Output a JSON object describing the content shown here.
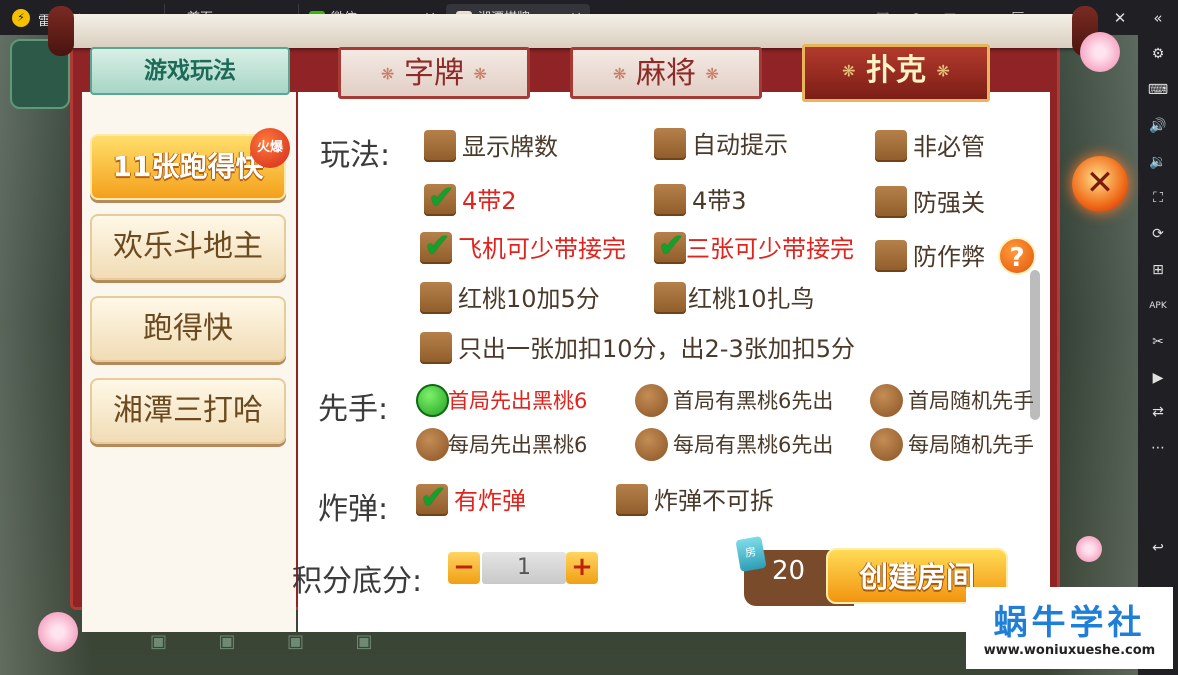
{
  "titlebar": {
    "app_name": "雷电模拟器",
    "tabs": [
      {
        "label": "首页"
      },
      {
        "label": "微信"
      },
      {
        "label": "湘潭棋牌"
      }
    ]
  },
  "game": {
    "mode_title": "游戏玩法",
    "categories": [
      {
        "label": "字牌"
      },
      {
        "label": "麻将"
      },
      {
        "label": "扑克"
      }
    ],
    "modes": [
      {
        "label": "11张跑得快"
      },
      {
        "label": "欢乐斗地主"
      },
      {
        "label": "跑得快"
      },
      {
        "label": "湘潭三打哈"
      }
    ],
    "hot_badge": "火爆",
    "rules": {
      "play_label": "玩法:",
      "first_label": "先手:",
      "bomb_label": "炸弹:",
      "options": {
        "show_count": "显示牌数",
        "auto_hint": "自动提示",
        "not_must": "非必管",
        "four_two": "4带2",
        "four_three": "4带3",
        "anti_strong": "防强关",
        "plane_less": "飞机可少带接完",
        "three_less": "三张可少带接完",
        "anti_cheat": "防作弊",
        "heart10_plus5": "红桃10加5分",
        "heart10_bird": "红桃10扎鸟",
        "single_bonus": "只出一张加扣10分，出2-3张加扣5分",
        "first_black6": "首局先出黑桃6",
        "first_has_black6": "首局有黑桃6先出",
        "first_random": "首局随机先手",
        "every_black6": "每局先出黑桃6",
        "every_has_black6": "每局有黑桃6先出",
        "every_random": "每局随机先手",
        "has_bomb": "有炸弹",
        "bomb_unsplit": "炸弹不可拆"
      }
    },
    "score": {
      "label": "积分底分:",
      "value": "1",
      "minus": "−",
      "plus": "+"
    },
    "cost": "20",
    "create_button": "创建房间",
    "close": "✕",
    "help": "?"
  },
  "watermark": {
    "title": "蜗牛学社",
    "url": "www.woniuxueshe.com"
  }
}
